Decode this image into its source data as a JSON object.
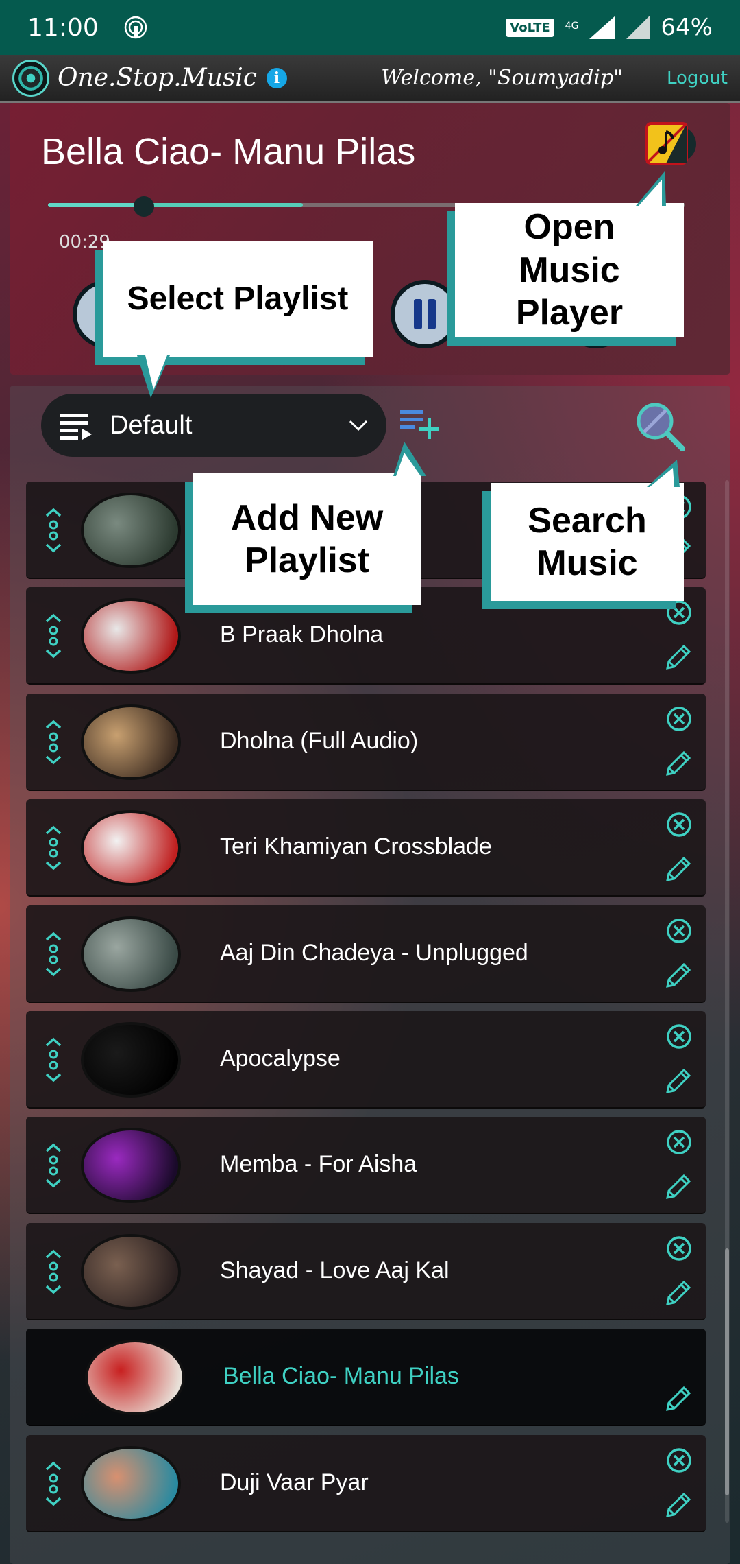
{
  "status_bar": {
    "time": "11:00",
    "volte": "VoLTE",
    "network": "4G",
    "battery": "64%"
  },
  "header": {
    "brand": "One.Stop.Music",
    "welcome": "Welcome, \"Soumyadip\"",
    "logout": "Logout"
  },
  "player": {
    "title": "Bella Ciao- Manu Pilas",
    "elapsed": "00:29",
    "progress_fraction": 0.15,
    "buffer_fraction": 0.4
  },
  "playlist": {
    "selected": "Default"
  },
  "tooltips": {
    "select_playlist": "Select Playlist",
    "open_player": "Open Music Player",
    "add_playlist": "Add New Playlist",
    "search_music": "Search Music"
  },
  "songs": [
    {
      "title": "",
      "colors": [
        "#7a8a80",
        "#2c3a30"
      ]
    },
    {
      "title": "B Praak Dholna",
      "colors": [
        "#e8e8e8",
        "#b01818"
      ]
    },
    {
      "title": "Dholna (Full Audio)",
      "colors": [
        "#c8a070",
        "#3a2a20"
      ]
    },
    {
      "title": "Teri Khamiyan Crossblade",
      "colors": [
        "#f2f2f2",
        "#c02020"
      ]
    },
    {
      "title": "Aaj Din Chadeya - Unplugged",
      "colors": [
        "#9aa6a0",
        "#3a4a46"
      ]
    },
    {
      "title": "Apocalypse",
      "colors": [
        "#1a1a1a",
        "#000000"
      ]
    },
    {
      "title": "Memba - For Aisha",
      "colors": [
        "#9a2ac0",
        "#1a0a2a"
      ]
    },
    {
      "title": "Shayad - Love Aaj Kal",
      "colors": [
        "#7a6050",
        "#2a2020"
      ]
    },
    {
      "title": "Bella Ciao- Manu Pilas",
      "colors": [
        "#c82020",
        "#e8e0d8"
      ],
      "active": true
    },
    {
      "title": "Duji Vaar Pyar",
      "colors": [
        "#d89070",
        "#2a8aa0"
      ]
    }
  ]
}
